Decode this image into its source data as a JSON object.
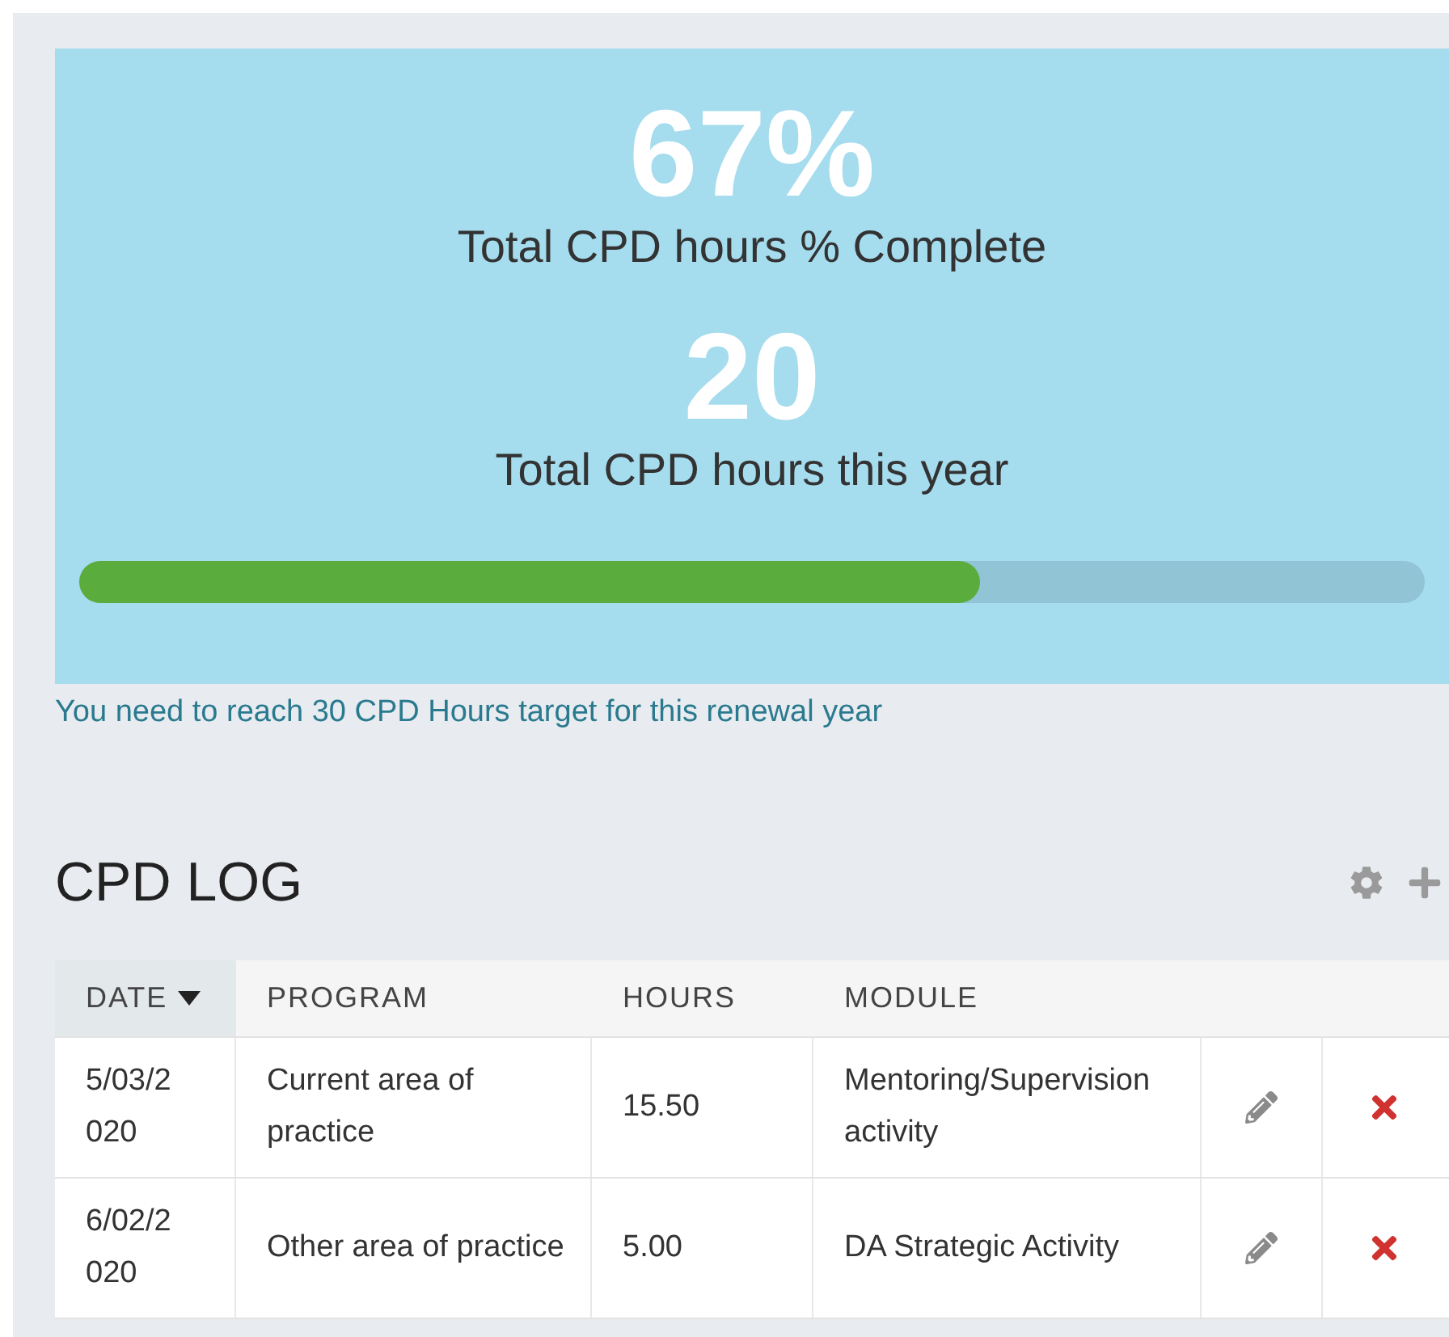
{
  "summary": {
    "percent": "67%",
    "percent_label": "Total CPD hours % Complete",
    "hours": "20",
    "hours_label": "Total CPD hours this year",
    "progress": {
      "level": 0.67
    }
  },
  "target_note": "You need to reach 30 CPD Hours target for this renewal year",
  "log": {
    "title": "CPD LOG",
    "columns": [
      {
        "label": "DATE",
        "sorted": true
      },
      {
        "label": "PROGRAM",
        "sorted": false
      },
      {
        "label": "HOURS",
        "sorted": false
      },
      {
        "label": "MODULE",
        "sorted": false
      }
    ],
    "rows": [
      {
        "date": "5/03/2020",
        "program": "Current area of practice",
        "hours": "15.50",
        "module": "Mentoring/Supervision activity"
      },
      {
        "date": "6/02/2020",
        "program": "Other area of practice",
        "hours": "5.00",
        "module": "DA Strategic Activity"
      }
    ]
  }
}
